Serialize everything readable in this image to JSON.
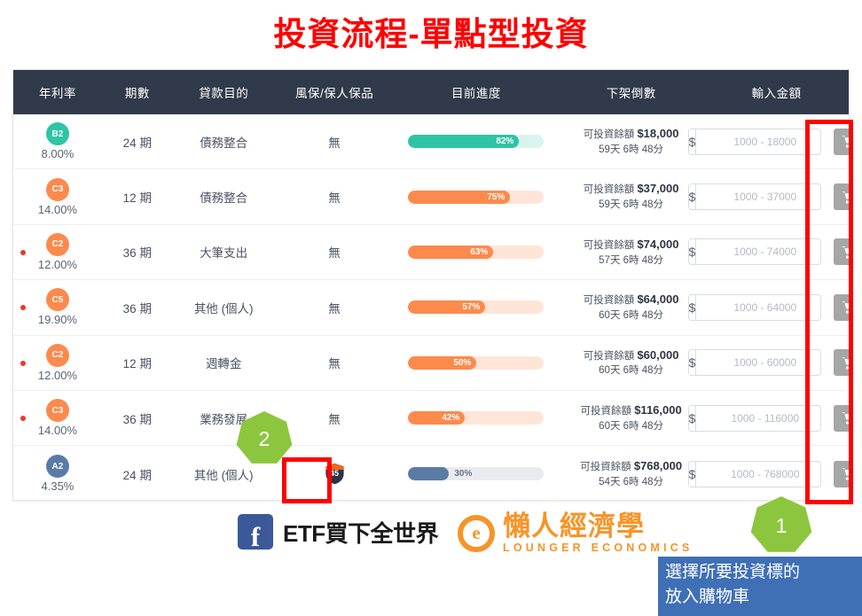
{
  "page": {
    "title": "投資流程-單點型投資"
  },
  "table": {
    "headers": [
      "年利率",
      "期數",
      "貸款目的",
      "風保/保人保品",
      "目前進度",
      "下架倒數",
      "輸入金額"
    ],
    "rows": [
      {
        "grade": "B2",
        "grade_color": "#2ec4a6",
        "rate": "8.00%",
        "has_alert_dot": false,
        "term": "24 期",
        "purpose": "債務整合",
        "guarantee": "無",
        "guarantee_icon": null,
        "progress_pct": 82,
        "progress_label": "82%",
        "progress_color": "#2ec4a6",
        "progress_track": "#d9f3ed",
        "remaining_label": "可投資餘額",
        "remaining_amount": "$18,000",
        "countdown": "59天 6時 48分",
        "amount_prefix": "$",
        "amount_placeholder": "1000 - 18000"
      },
      {
        "grade": "C3",
        "grade_color": "#fc8a4d",
        "rate": "14.00%",
        "has_alert_dot": false,
        "term": "12 期",
        "purpose": "債務整合",
        "guarantee": "無",
        "guarantee_icon": null,
        "progress_pct": 75,
        "progress_label": "75%",
        "progress_color": "#fc8a4d",
        "progress_track": "#ffe5d8",
        "remaining_label": "可投資餘額",
        "remaining_amount": "$37,000",
        "countdown": "59天 6時 48分",
        "amount_prefix": "$",
        "amount_placeholder": "1000 - 37000"
      },
      {
        "grade": "C2",
        "grade_color": "#fc8a4d",
        "rate": "12.00%",
        "has_alert_dot": true,
        "term": "36 期",
        "purpose": "大筆支出",
        "guarantee": "無",
        "guarantee_icon": null,
        "progress_pct": 63,
        "progress_label": "63%",
        "progress_color": "#fc8a4d",
        "progress_track": "#ffe5d8",
        "remaining_label": "可投資餘額",
        "remaining_amount": "$74,000",
        "countdown": "57天 6時 48分",
        "amount_prefix": "$",
        "amount_placeholder": "1000 - 74000"
      },
      {
        "grade": "C5",
        "grade_color": "#fc8a4d",
        "rate": "19.90%",
        "has_alert_dot": true,
        "term": "36 期",
        "purpose": "其他 (個人)",
        "guarantee": "無",
        "guarantee_icon": null,
        "progress_pct": 57,
        "progress_label": "57%",
        "progress_color": "#fc8a4d",
        "progress_track": "#ffe5d8",
        "remaining_label": "可投資餘額",
        "remaining_amount": "$64,000",
        "countdown": "60天 6時 48分",
        "amount_prefix": "$",
        "amount_placeholder": "1000 - 64000"
      },
      {
        "grade": "C2",
        "grade_color": "#fc8a4d",
        "rate": "12.00%",
        "has_alert_dot": true,
        "term": "12 期",
        "purpose": "週轉金",
        "guarantee": "無",
        "guarantee_icon": null,
        "progress_pct": 50,
        "progress_label": "50%",
        "progress_color": "#fc8a4d",
        "progress_track": "#ffe5d8",
        "remaining_label": "可投資餘額",
        "remaining_amount": "$60,000",
        "countdown": "60天 6時 48分",
        "amount_prefix": "$",
        "amount_placeholder": "1000 - 60000"
      },
      {
        "grade": "C3",
        "grade_color": "#fc8a4d",
        "rate": "14.00%",
        "has_alert_dot": true,
        "term": "36 期",
        "purpose": "業務發展",
        "guarantee": "無",
        "guarantee_icon": null,
        "progress_pct": 42,
        "progress_label": "42%",
        "progress_color": "#fc8a4d",
        "progress_track": "#ffe5d8",
        "remaining_label": "可投資餘額",
        "remaining_amount": "$116,000",
        "countdown": "60天 6時 48分",
        "amount_prefix": "$",
        "amount_placeholder": "1000 - 116000"
      },
      {
        "grade": "A2",
        "grade_color": "#5a7ba6",
        "rate": "4.35%",
        "has_alert_dot": false,
        "term": "24 期",
        "purpose": "其他 (個人)",
        "guarantee": "",
        "guarantee_icon": "shield-icon",
        "guarantee_icon_value": "45",
        "progress_pct": 30,
        "progress_label": "30%",
        "progress_color": "#5a7ba6",
        "progress_track": "#e9ebef",
        "remaining_label": "可投資餘額",
        "remaining_amount": "$768,000",
        "countdown": "54天 6時 48分",
        "amount_prefix": "$",
        "amount_placeholder": "1000 - 768000"
      }
    ]
  },
  "annotations": {
    "step_one": "1",
    "step_two": "2",
    "callout_line1": "選擇所要投資標的",
    "callout_line2": "放入購物車",
    "highlight_color": "#ff0000",
    "step_color": "#8cc63e",
    "callout_color": "#3f6fb5"
  },
  "footer": {
    "facebook_mark": "f",
    "facebook_page": "ETF買下全世界",
    "brand_mark": "e",
    "brand_cn": "懶人經濟學",
    "brand_en": "LOUNGER ECONOMICS"
  }
}
